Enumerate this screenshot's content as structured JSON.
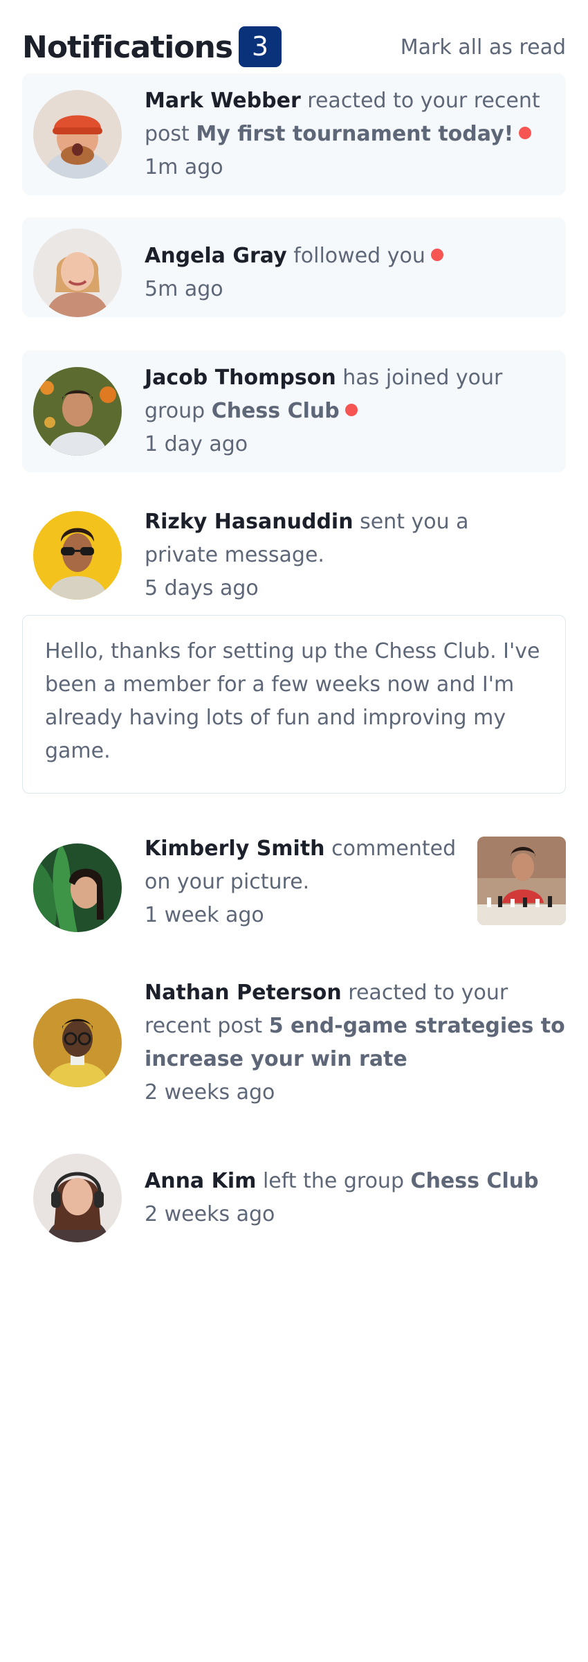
{
  "header": {
    "title": "Notifications",
    "unread_count": "3",
    "mark_all_label": "Mark all as read"
  },
  "notifications": [
    {
      "name": "Mark Webber",
      "action": "reacted to your recent post",
      "object": "My first tournament today!",
      "time": "1m ago",
      "unread": true,
      "avatar": "avatar-mark-webber"
    },
    {
      "name": "Angela Gray",
      "action": "followed you",
      "time": "5m ago",
      "unread": true,
      "avatar": "avatar-angela-gray"
    },
    {
      "name": "Jacob Thompson",
      "action": "has joined your group",
      "object": "Chess Club",
      "time": "1 day ago",
      "unread": true,
      "avatar": "avatar-jacob-thompson"
    },
    {
      "name": "Rizky Hasanuddin",
      "action": "sent you a private message.",
      "time": "5 days ago",
      "unread": false,
      "avatar": "avatar-rizky-hasanuddin",
      "message": "Hello, thanks for setting up the Chess Club. I've been a member for a few weeks now and I'm already having lots of fun and improving my game."
    },
    {
      "name": "Kimberly Smith",
      "action": "commented on your picture.",
      "time": "1 week ago",
      "unread": false,
      "avatar": "avatar-kimberly-smith",
      "picture": "chess-picture"
    },
    {
      "name": "Nathan Peterson",
      "action": "reacted to your recent post",
      "object": "5 end-game strategies to increase your win rate",
      "time": "2 weeks ago",
      "unread": false,
      "avatar": "avatar-nathan-peterson"
    },
    {
      "name": "Anna Kim",
      "action": "left the group",
      "object": "Chess Club",
      "time": "2 weeks ago",
      "unread": false,
      "avatar": "avatar-anna-kim"
    }
  ],
  "colors": {
    "badge": "#0a327b",
    "unread_bg": "#f6f9fc",
    "dot": "#f65552",
    "heading": "#1c202b",
    "text": "#5e6778"
  }
}
